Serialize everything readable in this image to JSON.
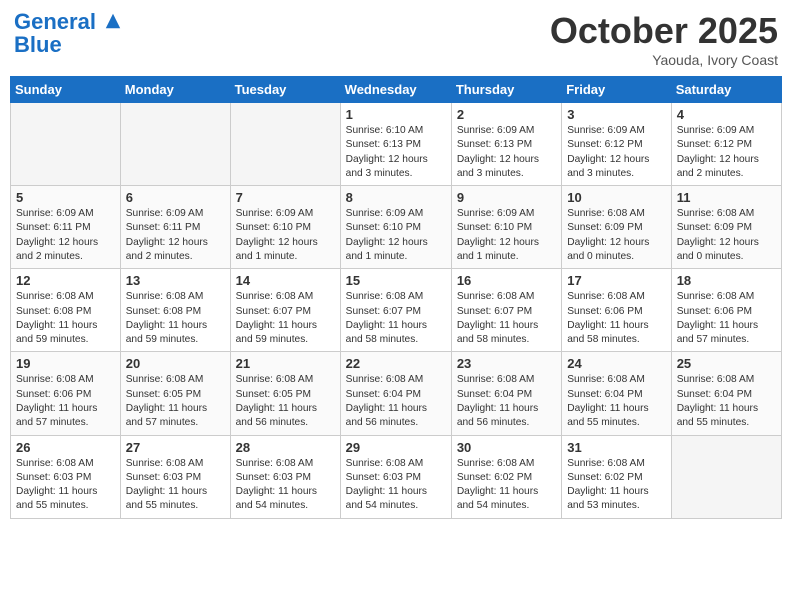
{
  "header": {
    "logo_line1": "General",
    "logo_line2": "Blue",
    "month": "October 2025",
    "location": "Yaouda, Ivory Coast"
  },
  "weekdays": [
    "Sunday",
    "Monday",
    "Tuesday",
    "Wednesday",
    "Thursday",
    "Friday",
    "Saturday"
  ],
  "weeks": [
    [
      {
        "day": "",
        "info": ""
      },
      {
        "day": "",
        "info": ""
      },
      {
        "day": "",
        "info": ""
      },
      {
        "day": "1",
        "info": "Sunrise: 6:10 AM\nSunset: 6:13 PM\nDaylight: 12 hours\nand 3 minutes."
      },
      {
        "day": "2",
        "info": "Sunrise: 6:09 AM\nSunset: 6:13 PM\nDaylight: 12 hours\nand 3 minutes."
      },
      {
        "day": "3",
        "info": "Sunrise: 6:09 AM\nSunset: 6:12 PM\nDaylight: 12 hours\nand 3 minutes."
      },
      {
        "day": "4",
        "info": "Sunrise: 6:09 AM\nSunset: 6:12 PM\nDaylight: 12 hours\nand 2 minutes."
      }
    ],
    [
      {
        "day": "5",
        "info": "Sunrise: 6:09 AM\nSunset: 6:11 PM\nDaylight: 12 hours\nand 2 minutes."
      },
      {
        "day": "6",
        "info": "Sunrise: 6:09 AM\nSunset: 6:11 PM\nDaylight: 12 hours\nand 2 minutes."
      },
      {
        "day": "7",
        "info": "Sunrise: 6:09 AM\nSunset: 6:10 PM\nDaylight: 12 hours\nand 1 minute."
      },
      {
        "day": "8",
        "info": "Sunrise: 6:09 AM\nSunset: 6:10 PM\nDaylight: 12 hours\nand 1 minute."
      },
      {
        "day": "9",
        "info": "Sunrise: 6:09 AM\nSunset: 6:10 PM\nDaylight: 12 hours\nand 1 minute."
      },
      {
        "day": "10",
        "info": "Sunrise: 6:08 AM\nSunset: 6:09 PM\nDaylight: 12 hours\nand 0 minutes."
      },
      {
        "day": "11",
        "info": "Sunrise: 6:08 AM\nSunset: 6:09 PM\nDaylight: 12 hours\nand 0 minutes."
      }
    ],
    [
      {
        "day": "12",
        "info": "Sunrise: 6:08 AM\nSunset: 6:08 PM\nDaylight: 11 hours\nand 59 minutes."
      },
      {
        "day": "13",
        "info": "Sunrise: 6:08 AM\nSunset: 6:08 PM\nDaylight: 11 hours\nand 59 minutes."
      },
      {
        "day": "14",
        "info": "Sunrise: 6:08 AM\nSunset: 6:07 PM\nDaylight: 11 hours\nand 59 minutes."
      },
      {
        "day": "15",
        "info": "Sunrise: 6:08 AM\nSunset: 6:07 PM\nDaylight: 11 hours\nand 58 minutes."
      },
      {
        "day": "16",
        "info": "Sunrise: 6:08 AM\nSunset: 6:07 PM\nDaylight: 11 hours\nand 58 minutes."
      },
      {
        "day": "17",
        "info": "Sunrise: 6:08 AM\nSunset: 6:06 PM\nDaylight: 11 hours\nand 58 minutes."
      },
      {
        "day": "18",
        "info": "Sunrise: 6:08 AM\nSunset: 6:06 PM\nDaylight: 11 hours\nand 57 minutes."
      }
    ],
    [
      {
        "day": "19",
        "info": "Sunrise: 6:08 AM\nSunset: 6:06 PM\nDaylight: 11 hours\nand 57 minutes."
      },
      {
        "day": "20",
        "info": "Sunrise: 6:08 AM\nSunset: 6:05 PM\nDaylight: 11 hours\nand 57 minutes."
      },
      {
        "day": "21",
        "info": "Sunrise: 6:08 AM\nSunset: 6:05 PM\nDaylight: 11 hours\nand 56 minutes."
      },
      {
        "day": "22",
        "info": "Sunrise: 6:08 AM\nSunset: 6:04 PM\nDaylight: 11 hours\nand 56 minutes."
      },
      {
        "day": "23",
        "info": "Sunrise: 6:08 AM\nSunset: 6:04 PM\nDaylight: 11 hours\nand 56 minutes."
      },
      {
        "day": "24",
        "info": "Sunrise: 6:08 AM\nSunset: 6:04 PM\nDaylight: 11 hours\nand 55 minutes."
      },
      {
        "day": "25",
        "info": "Sunrise: 6:08 AM\nSunset: 6:04 PM\nDaylight: 11 hours\nand 55 minutes."
      }
    ],
    [
      {
        "day": "26",
        "info": "Sunrise: 6:08 AM\nSunset: 6:03 PM\nDaylight: 11 hours\nand 55 minutes."
      },
      {
        "day": "27",
        "info": "Sunrise: 6:08 AM\nSunset: 6:03 PM\nDaylight: 11 hours\nand 55 minutes."
      },
      {
        "day": "28",
        "info": "Sunrise: 6:08 AM\nSunset: 6:03 PM\nDaylight: 11 hours\nand 54 minutes."
      },
      {
        "day": "29",
        "info": "Sunrise: 6:08 AM\nSunset: 6:03 PM\nDaylight: 11 hours\nand 54 minutes."
      },
      {
        "day": "30",
        "info": "Sunrise: 6:08 AM\nSunset: 6:02 PM\nDaylight: 11 hours\nand 54 minutes."
      },
      {
        "day": "31",
        "info": "Sunrise: 6:08 AM\nSunset: 6:02 PM\nDaylight: 11 hours\nand 53 minutes."
      },
      {
        "day": "",
        "info": ""
      }
    ]
  ]
}
